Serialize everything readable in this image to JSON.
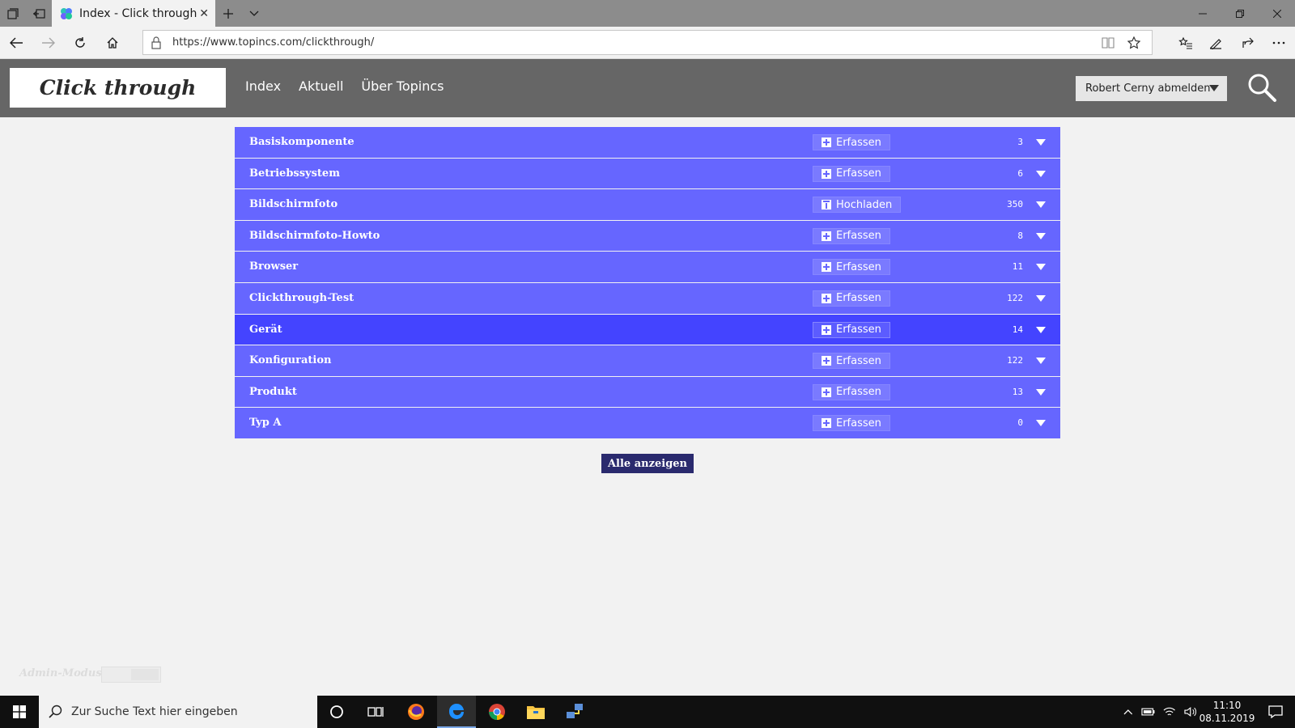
{
  "browser": {
    "tab_title": "Index - Click through",
    "url": "https://www.topincs.com/clickthrough/"
  },
  "site": {
    "logo_text": "Click through",
    "menu": [
      {
        "label": "Index"
      },
      {
        "label": "Aktuell"
      },
      {
        "label": "Über Topincs"
      }
    ],
    "user_button": "Robert Cerny abmelden"
  },
  "list": {
    "rows": [
      {
        "name": "Basiskomponente",
        "action": "Erfassen",
        "action_icon": "plus-box-icon",
        "count": "3"
      },
      {
        "name": "Betriebssystem",
        "action": "Erfassen",
        "action_icon": "plus-box-icon",
        "count": "6"
      },
      {
        "name": "Bildschirmfoto",
        "action": "Hochladen",
        "action_icon": "upload-icon",
        "count": "350"
      },
      {
        "name": "Bildschirmfoto-Howto",
        "action": "Erfassen",
        "action_icon": "plus-box-icon",
        "count": "8"
      },
      {
        "name": "Browser",
        "action": "Erfassen",
        "action_icon": "plus-box-icon",
        "count": "11"
      },
      {
        "name": "Clickthrough-Test",
        "action": "Erfassen",
        "action_icon": "plus-box-icon",
        "count": "122"
      },
      {
        "name": "Gerät",
        "action": "Erfassen",
        "action_icon": "plus-box-icon",
        "count": "14",
        "active": true
      },
      {
        "name": "Konfiguration",
        "action": "Erfassen",
        "action_icon": "plus-box-icon",
        "count": "122"
      },
      {
        "name": "Produkt",
        "action": "Erfassen",
        "action_icon": "plus-box-icon",
        "count": "13"
      },
      {
        "name": "Typ A",
        "action": "Erfassen",
        "action_icon": "plus-box-icon",
        "count": "0"
      }
    ],
    "show_all": "Alle anzeigen"
  },
  "admin": {
    "label": "Admin-Modus"
  },
  "taskbar": {
    "search_placeholder": "Zur Suche Text hier eingeben",
    "time": "11:10",
    "date": "08.11.2019"
  },
  "colors": {
    "row": "#6666ff",
    "row_active": "#4444ff",
    "header": "#666666",
    "show_all": "#2a2a6e"
  }
}
